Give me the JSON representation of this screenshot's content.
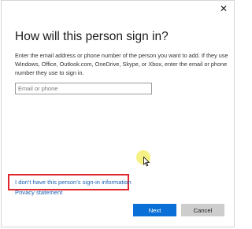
{
  "dialog": {
    "close_glyph": "✕",
    "title": "How will this person sign in?",
    "description": "Enter the email address or phone number of the person you want to add. If they use Windows, Office, Outlook.com, OneDrive, Skype, or Xbox, enter the email or phone number they use to sign in.",
    "email_input": {
      "placeholder": "Email or phone",
      "value": ""
    },
    "no_signin_info_link": "I don't have this person's sign-in information",
    "privacy_link": "Privacy statement",
    "next_button": "Next",
    "cancel_button": "Cancel"
  },
  "colors": {
    "accent": "#0a6fd6",
    "link": "#1a62b4",
    "highlight_border": "#e0262c",
    "cursor_highlight": "#f5ee6e"
  },
  "icons": {
    "close": "close-icon",
    "pointer": "mouse-pointer-icon"
  }
}
